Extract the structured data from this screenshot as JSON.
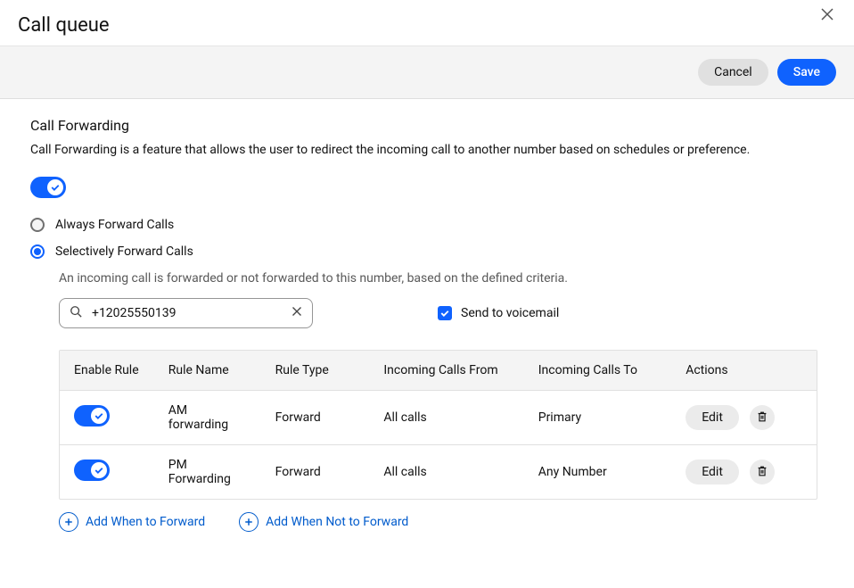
{
  "dialog": {
    "title": "Call queue"
  },
  "toolbar": {
    "cancel": "Cancel",
    "save": "Save"
  },
  "section": {
    "title": "Call Forwarding",
    "description": "Call Forwarding is a feature that allows the user to redirect the incoming call to another number based on schedules or preference."
  },
  "radios": {
    "always": "Always Forward Calls",
    "selective": "Selectively Forward Calls"
  },
  "subdesc": "An incoming call is forwarded or not forwarded to this number, based on the defined criteria.",
  "search": {
    "value": "+12025550139"
  },
  "voicemail": {
    "label": "Send to voicemail"
  },
  "table": {
    "headers": {
      "enable": "Enable Rule",
      "name": "Rule Name",
      "type": "Rule Type",
      "from": "Incoming Calls From",
      "to": "Incoming Calls To",
      "actions": "Actions"
    },
    "rows": [
      {
        "name": "AM forwarding",
        "type": "Forward",
        "from": "All calls",
        "to": "Primary",
        "edit": "Edit"
      },
      {
        "name": "PM Forwarding",
        "type": "Forward",
        "from": "All calls",
        "to": "Any Number",
        "edit": "Edit"
      }
    ]
  },
  "addLinks": {
    "whenToForward": "Add When to Forward",
    "whenNotToForward": "Add When Not to Forward"
  }
}
